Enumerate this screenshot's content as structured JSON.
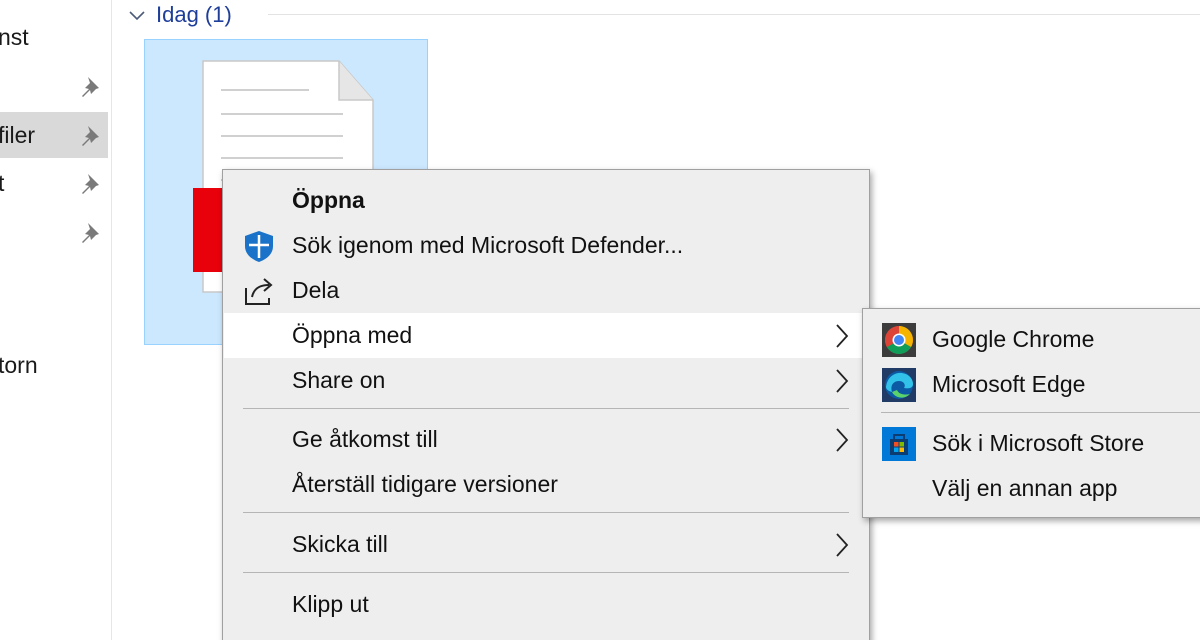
{
  "nav": {
    "items": [
      {
        "label": "nst",
        "pinned": false,
        "selected": false
      },
      {
        "label": "",
        "pinned": true,
        "selected": false
      },
      {
        "label": "filer",
        "pinned": true,
        "selected": true
      },
      {
        "label": "t",
        "pinned": true,
        "selected": false
      },
      {
        "label": "",
        "pinned": true,
        "selected": false
      },
      {
        "label": "torn",
        "pinned": false,
        "selected": false
      }
    ]
  },
  "group": {
    "title": "Idag (1)"
  },
  "file": {
    "icon": "pdf-document-icon",
    "accent_color": "#e8000b"
  },
  "context_menu": {
    "items": [
      {
        "label": "Öppna",
        "bold": true,
        "icon": null,
        "submenu": false
      },
      {
        "label": "Sök igenom med Microsoft Defender...",
        "icon": "defender-shield-icon",
        "submenu": false
      },
      {
        "label": "Dela",
        "icon": "share-icon",
        "submenu": false
      },
      {
        "label": "Öppna med",
        "icon": null,
        "submenu": true,
        "highlighted": true
      },
      {
        "label": "Share on",
        "icon": null,
        "submenu": true
      },
      {
        "label": "Ge åtkomst till",
        "icon": null,
        "submenu": true
      },
      {
        "label": "Återställ tidigare versioner",
        "icon": null,
        "submenu": false
      },
      {
        "label": "Skicka till",
        "icon": null,
        "submenu": true
      },
      {
        "label": "Klipp ut",
        "icon": null,
        "submenu": false
      }
    ]
  },
  "open_with_submenu": {
    "items": [
      {
        "label": "Google Chrome",
        "icon": "chrome-icon"
      },
      {
        "label": "Microsoft Edge",
        "icon": "edge-icon"
      },
      {
        "label": "Sök i Microsoft Store",
        "icon": "store-icon"
      },
      {
        "label": "Välj en annan app",
        "icon": null
      }
    ]
  },
  "colors": {
    "selection_bg": "#cce8ff",
    "selection_border": "#99d1ff",
    "menu_bg": "#eeeeee",
    "group_title": "#1e3e9a"
  }
}
